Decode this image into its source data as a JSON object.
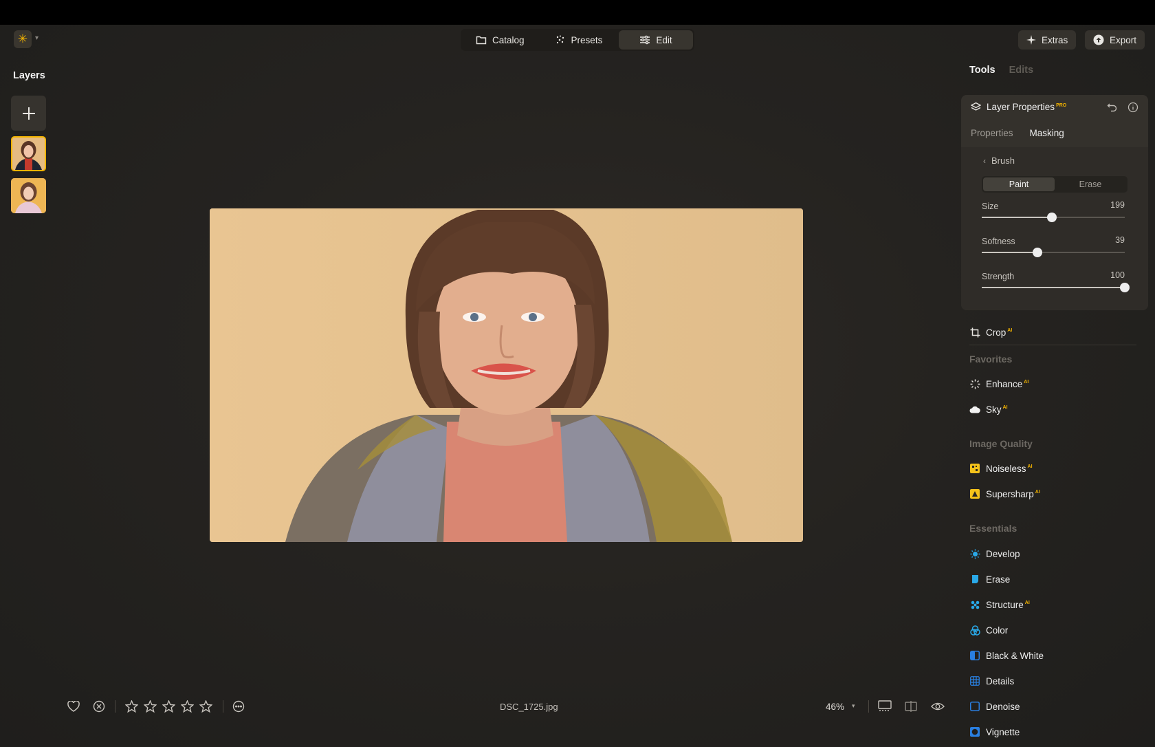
{
  "header": {
    "modes": [
      {
        "label": "Catalog",
        "icon": "folder-icon"
      },
      {
        "label": "Presets",
        "icon": "sparkle-dots-icon"
      },
      {
        "label": "Edit",
        "icon": "sliders-icon"
      }
    ],
    "active_mode": "Edit",
    "extras_label": "Extras",
    "export_label": "Export"
  },
  "layers": {
    "title": "Layers",
    "selected_index": 0
  },
  "right_panel": {
    "tabs": [
      "Tools",
      "Edits"
    ],
    "active_tab": "Tools",
    "layer_properties": {
      "title": "Layer Properties",
      "badge": "PRO",
      "subtabs": [
        "Properties",
        "Masking"
      ],
      "active_subtab": "Masking",
      "brush_label": "Brush",
      "modes": [
        "Paint",
        "Erase"
      ],
      "active_mode": "Paint",
      "sliders": [
        {
          "label": "Size",
          "value": "199",
          "fraction": 0.49
        },
        {
          "label": "Softness",
          "value": "39",
          "fraction": 0.39
        },
        {
          "label": "Strength",
          "value": "100",
          "fraction": 1.0
        }
      ]
    },
    "crop": {
      "label": "Crop",
      "badge": "AI"
    },
    "sections": {
      "favorites": "Favorites",
      "image_quality": "Image Quality",
      "essentials": "Essentials"
    },
    "favorites": [
      {
        "label": "Enhance",
        "badge": "AI",
        "icon": "enhance-icon"
      },
      {
        "label": "Sky",
        "badge": "AI",
        "icon": "cloud-icon"
      }
    ],
    "image_quality": [
      {
        "label": "Noiseless",
        "badge": "AI",
        "icon": "noiseless-icon"
      },
      {
        "label": "Supersharp",
        "badge": "AI",
        "icon": "supersharp-icon"
      }
    ],
    "essentials": [
      {
        "label": "Develop",
        "badge": "",
        "icon": "sun-icon"
      },
      {
        "label": "Erase",
        "badge": "",
        "icon": "eraser-icon"
      },
      {
        "label": "Structure",
        "badge": "AI",
        "icon": "structure-icon"
      },
      {
        "label": "Color",
        "badge": "",
        "icon": "color-icon"
      },
      {
        "label": "Black & White",
        "badge": "",
        "icon": "bw-icon"
      },
      {
        "label": "Details",
        "badge": "",
        "icon": "details-icon"
      },
      {
        "label": "Denoise",
        "badge": "",
        "icon": "denoise-icon"
      },
      {
        "label": "Vignette",
        "badge": "",
        "icon": "vignette-icon"
      }
    ]
  },
  "footer": {
    "filename": "DSC_1725.jpg",
    "zoom": "46%",
    "rating": 0,
    "max_rating": 5
  },
  "colors": {
    "accent": "#f4b400",
    "background": "#252320",
    "panel": "#34312c"
  }
}
